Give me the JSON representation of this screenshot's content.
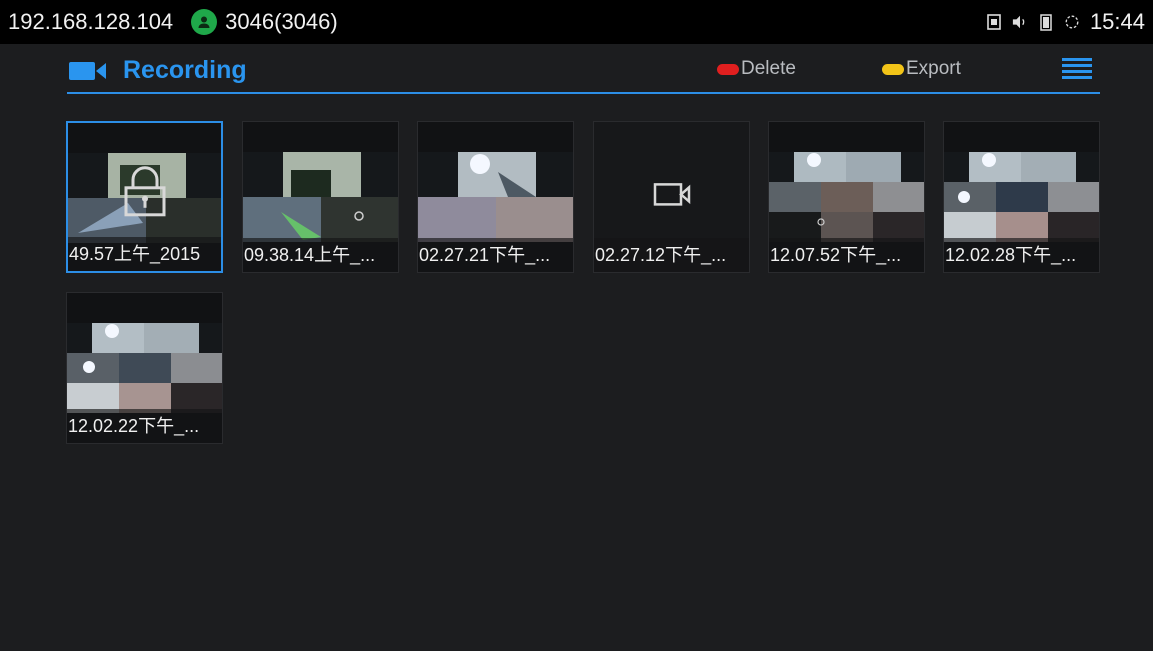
{
  "status": {
    "ip": "192.168.128.104",
    "account": "3046(3046)",
    "time": "15:44",
    "icons": [
      "sim-icon",
      "volume-icon",
      "battery-icon",
      "sync-icon"
    ]
  },
  "header": {
    "title": "Recording",
    "delete_label": "Delete",
    "export_label": "Export",
    "accent": "#2a95ef",
    "delete_color": "#e01f1f",
    "export_color": "#f2c418"
  },
  "recordings": [
    {
      "label": "49.57上午_2015",
      "locked": true
    },
    {
      "label": "09.38.14上午_..."
    },
    {
      "label": "02.27.21下午_..."
    },
    {
      "label": "02.27.12下午_...",
      "placeholder": true
    },
    {
      "label": "12.07.52下午_..."
    },
    {
      "label": "12.02.28下午_..."
    },
    {
      "label": "12.02.22下午_..."
    }
  ]
}
